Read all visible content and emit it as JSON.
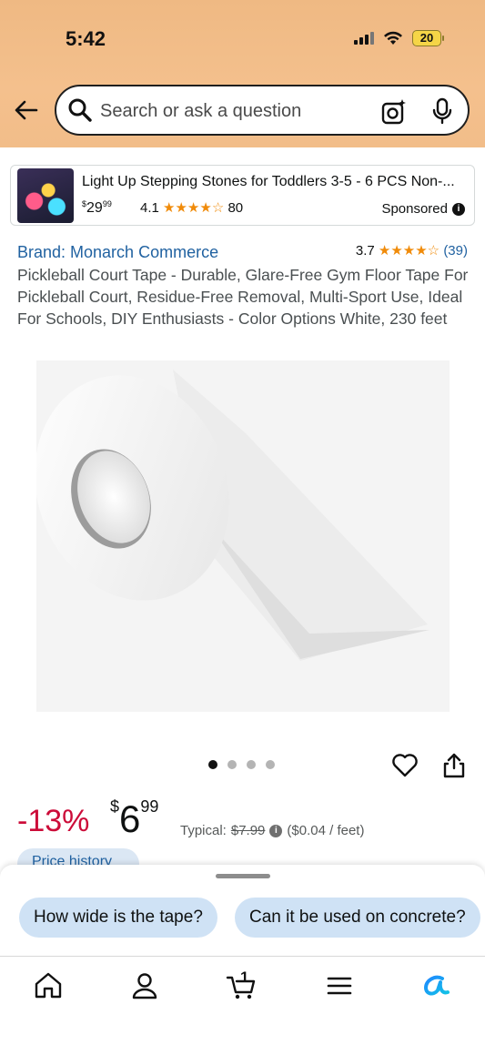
{
  "status_bar": {
    "time": "5:42",
    "battery": "20"
  },
  "search": {
    "placeholder": "Search or ask a question"
  },
  "sponsored": {
    "title": "Light Up Stepping Stones for Toddlers 3-5 - 6 PCS Non-...",
    "price_symbol": "$",
    "price_whole": "29",
    "price_fraction": "99",
    "rating_value": "4.1",
    "stars": "★★★★☆",
    "rating_count": "80",
    "label": "Sponsored"
  },
  "product": {
    "brand": "Brand: Monarch Commerce",
    "rating_value": "3.7",
    "stars": "★★★★☆",
    "rating_count": "(39)",
    "title": "Pickleball Court Tape - Durable, Glare-Free Gym Floor Tape For Pickleball Court, Residue-Free Removal, Multi-Sport Use, Ideal For Schools, DIY Enthusiasts - Color Options White, 230 feet",
    "image_count": 4,
    "image_index": 1
  },
  "pricing": {
    "discount": "-13%",
    "currency": "$",
    "whole": "6",
    "fraction": "99",
    "typical_label": "Typical:",
    "typical_price": "$7.99",
    "unit_price": "($0.04 / feet)",
    "price_history": "Price history"
  },
  "suggestions": [
    {
      "label": "How wide is the tape?"
    },
    {
      "label": "Can it be used on concrete?"
    }
  ],
  "tabbar": {
    "cart_count": "1",
    "tabs": [
      "home-icon",
      "account-icon",
      "cart-icon",
      "menu-icon",
      "rufus-icon"
    ]
  },
  "colors": {
    "header": "#efb983",
    "link": "#2162a1",
    "discount": "#cc0c39",
    "star": "#f08b0a",
    "chip": "#cfe2f5"
  }
}
